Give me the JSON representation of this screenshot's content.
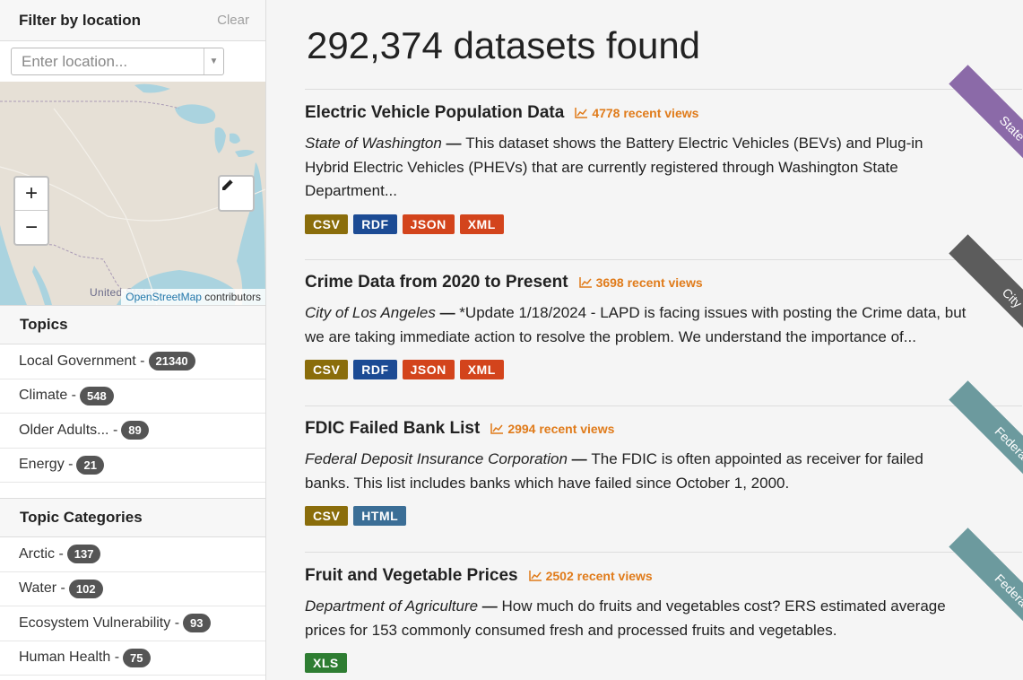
{
  "sidebar": {
    "filter_title": "Filter by location",
    "clear_label": "Clear",
    "location_placeholder": "Enter location...",
    "map": {
      "label": "United States",
      "zoom_in": "+",
      "zoom_out": "−",
      "attribution_link": "OpenStreetMap",
      "attribution_text": " contributors"
    },
    "topics": {
      "title": "Topics",
      "items": [
        {
          "label": "Local Government - ",
          "count": "21340"
        },
        {
          "label": "Climate - ",
          "count": "548"
        },
        {
          "label": "Older Adults... - ",
          "count": "89"
        },
        {
          "label": "Energy - ",
          "count": "21"
        }
      ]
    },
    "topic_categories": {
      "title": "Topic Categories",
      "items": [
        {
          "label": "Arctic - ",
          "count": "137"
        },
        {
          "label": "Water - ",
          "count": "102"
        },
        {
          "label": "Ecosystem Vulnerability - ",
          "count": "93"
        },
        {
          "label": "Human Health - ",
          "count": "75"
        }
      ]
    }
  },
  "main": {
    "results_count": "292,374 datasets found",
    "datasets": [
      {
        "title": "Electric Vehicle Population Data",
        "views": "4778 recent views",
        "org": "State of Washington",
        "dash": " — ",
        "description": "This dataset shows the Battery Electric Vehicles (BEVs) and Plug-in Hybrid Electric Vehicles (PHEVs) that are currently registered through Washington State Department...",
        "ribbon": "State",
        "ribbon_color": "#8b6aa8",
        "formats": [
          {
            "label": "CSV",
            "color": "#8a6d0b"
          },
          {
            "label": "RDF",
            "color": "#1c4b94"
          },
          {
            "label": "JSON",
            "color": "#d3441c"
          },
          {
            "label": "XML",
            "color": "#d3441c"
          }
        ]
      },
      {
        "title": "Crime Data from 2020 to Present",
        "views": "3698 recent views",
        "org": "City of Los Angeles",
        "dash": " — ",
        "description": "*Update 1/18/2024 - LAPD is facing issues with posting the Crime data, but we are taking immediate action to resolve the problem. We understand the importance of...",
        "ribbon": "City",
        "ribbon_color": "#5c5c5c",
        "formats": [
          {
            "label": "CSV",
            "color": "#8a6d0b"
          },
          {
            "label": "RDF",
            "color": "#1c4b94"
          },
          {
            "label": "JSON",
            "color": "#d3441c"
          },
          {
            "label": "XML",
            "color": "#d3441c"
          }
        ]
      },
      {
        "title": "FDIC Failed Bank List",
        "views": "2994 recent views",
        "org": "Federal Deposit Insurance Corporation",
        "dash": " — ",
        "description": "The FDIC is often appointed as receiver for failed banks. This list includes banks which have failed since October 1, 2000.",
        "ribbon": "Federal",
        "ribbon_color": "#6c9a9e",
        "formats": [
          {
            "label": "CSV",
            "color": "#8a6d0b"
          },
          {
            "label": "HTML",
            "color": "#3b6e96"
          }
        ]
      },
      {
        "title": "Fruit and Vegetable Prices",
        "views": "2502 recent views",
        "org": "Department of Agriculture",
        "dash": " — ",
        "description": "How much do fruits and vegetables cost? ERS estimated average prices for 153 commonly consumed fresh and processed fruits and vegetables.",
        "ribbon": "Federal",
        "ribbon_color": "#6c9a9e",
        "formats": [
          {
            "label": "XLS",
            "color": "#2e7d32"
          }
        ]
      }
    ]
  }
}
